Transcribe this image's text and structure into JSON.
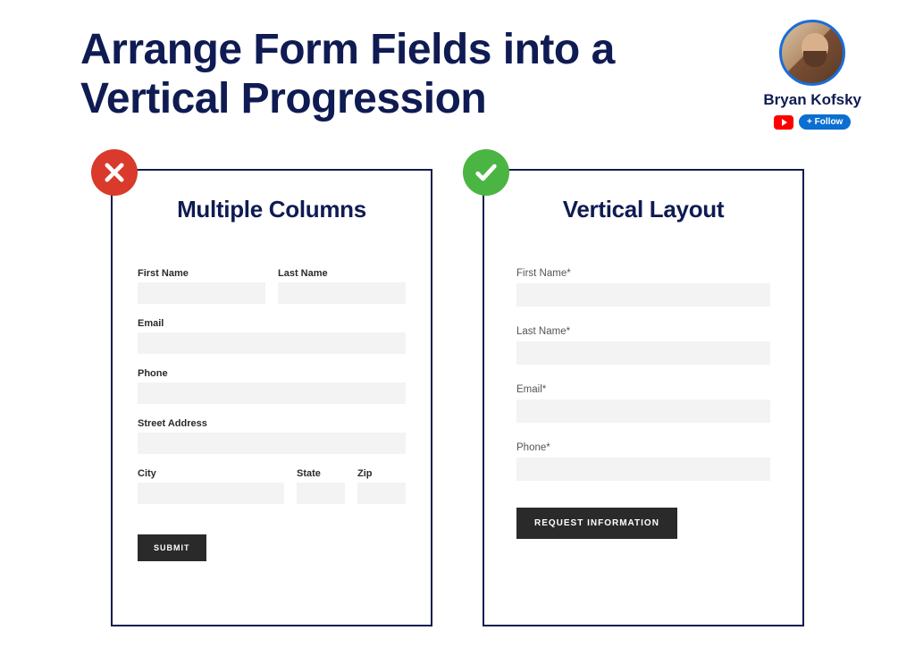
{
  "title": "Arrange Form Fields into a Vertical Progression",
  "author": {
    "name": "Bryan Kofsky",
    "follow_label": "+ Follow"
  },
  "bad_card": {
    "title": "Multiple Columns",
    "fields": {
      "first_name": "First Name",
      "last_name": "Last Name",
      "email": "Email",
      "phone": "Phone",
      "street": "Street Address",
      "city": "City",
      "state": "State",
      "zip": "Zip"
    },
    "submit": "SUBMIT"
  },
  "good_card": {
    "title": "Vertical Layout",
    "fields": {
      "first_name": "First Name*",
      "last_name": "Last Name*",
      "email": "Email*",
      "phone": "Phone*"
    },
    "submit": "REQUEST INFORMATION"
  }
}
